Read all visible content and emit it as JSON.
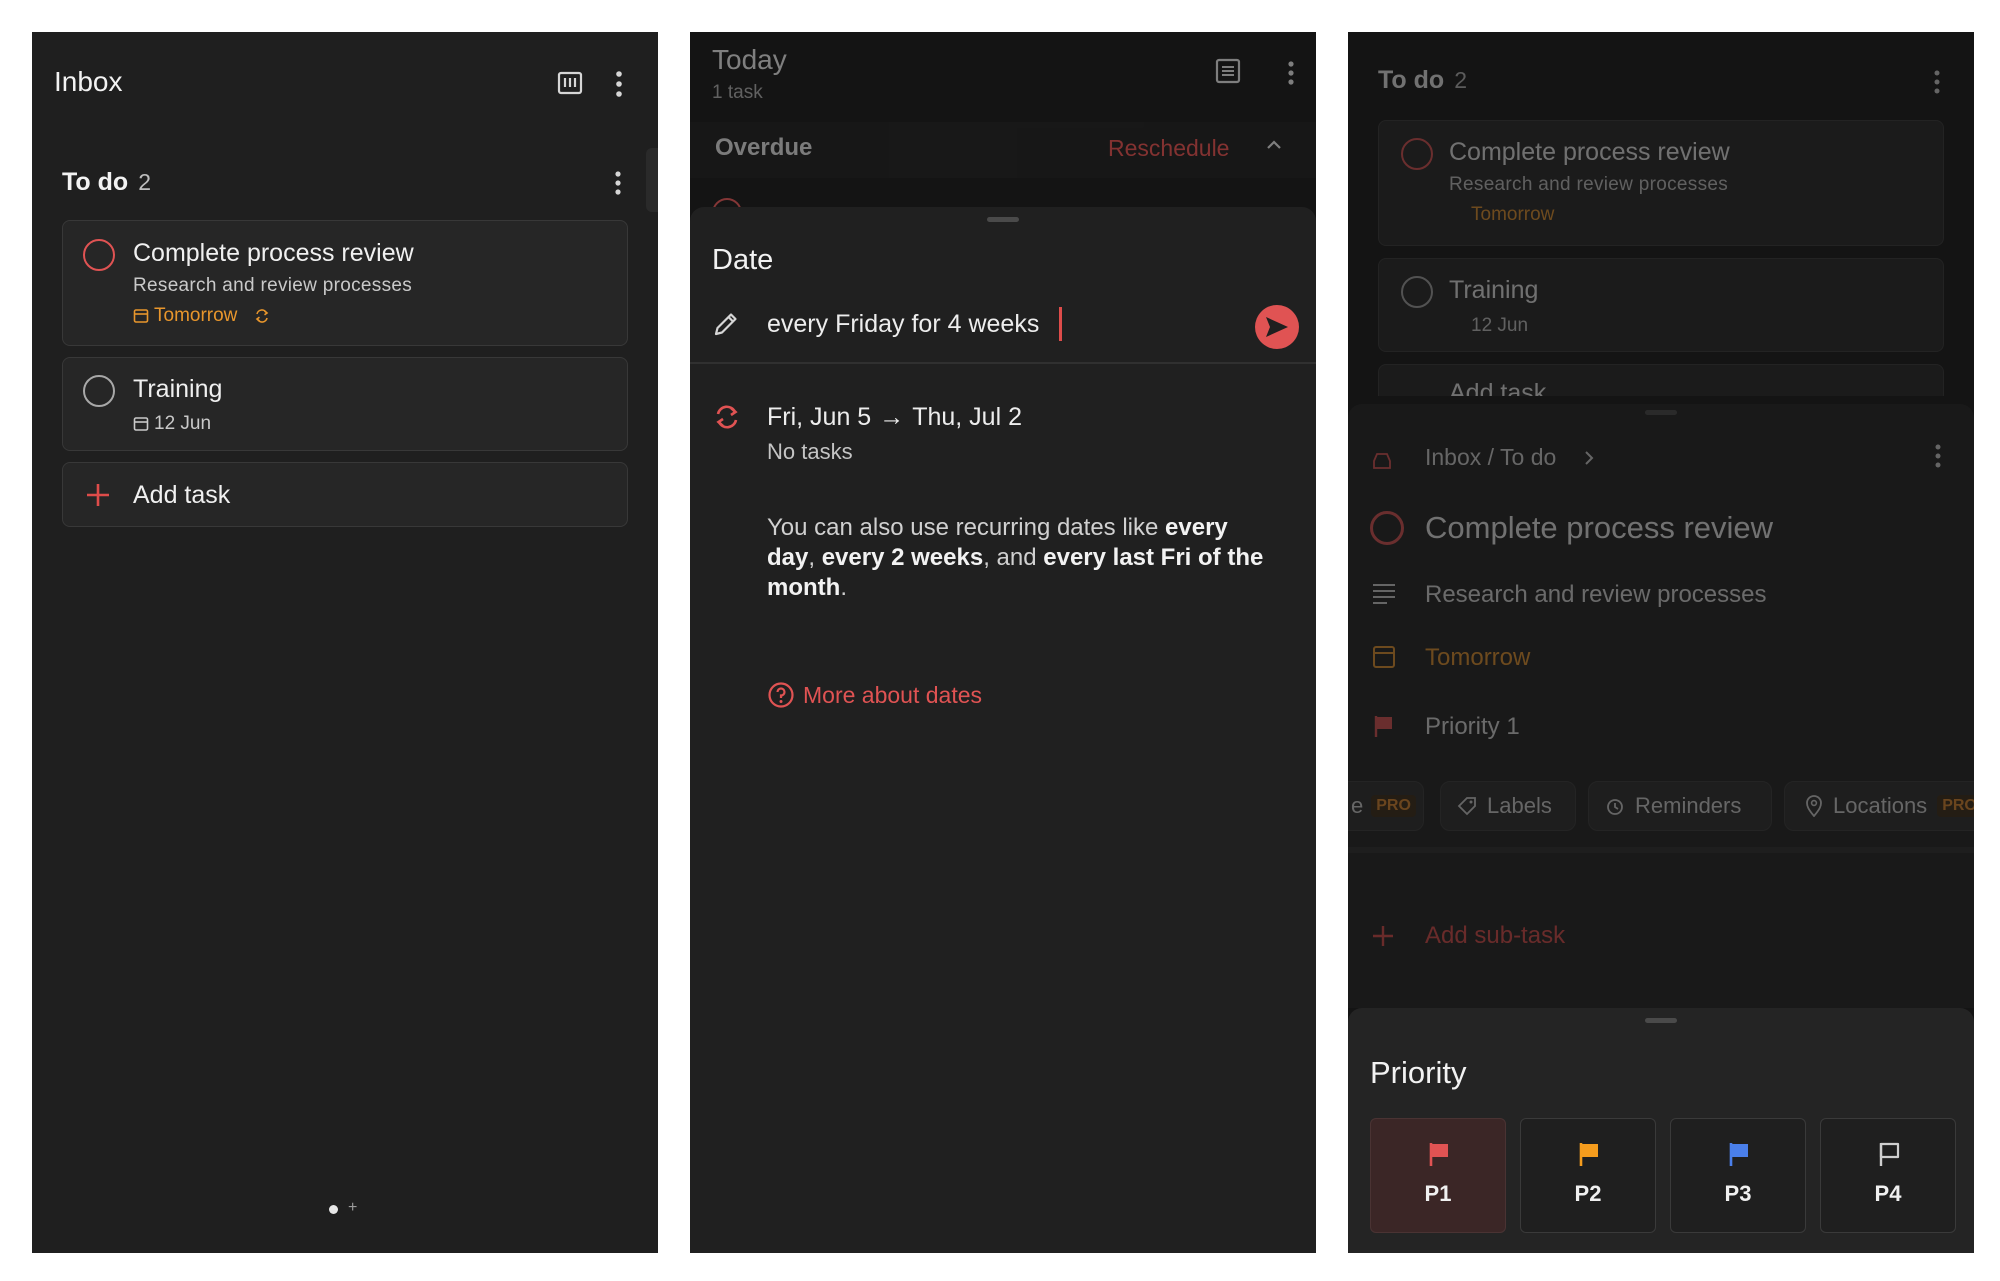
{
  "colors": {
    "accent": "#de4c4a",
    "date_orange": "#e8962c",
    "p1": "#e05353",
    "p2": "#f59c1d",
    "p3": "#4a7fea",
    "p4": "#cfcfcf",
    "panel_bg": "#1f1f1f"
  },
  "inbox": {
    "title": "Inbox",
    "section": {
      "title": "To do",
      "count": "2"
    },
    "tasks": [
      {
        "title": "Complete process review",
        "description": "Research and review processes",
        "date": "Tomorrow"
      },
      {
        "title": "Training",
        "date": "12 Jun"
      }
    ],
    "add_task": "Add task"
  },
  "today": {
    "title": "Today",
    "subtitle": "1 task",
    "overdue": "Overdue",
    "reschedule": "Reschedule",
    "sheet": {
      "title": "Date",
      "input_value": "every Friday for 4 weeks",
      "range_start": "Fri, Jun 5",
      "range_end": "Thu, Jul 2",
      "range_arrow": "→",
      "no_tasks": "No tasks",
      "help_1": "You can also use recurring dates like",
      "help_b1": "every day",
      "help_2": ",",
      "help_b2": "every 2 weeks",
      "help_3": ", and",
      "help_b3": "every last Fri of the month",
      "help_4": ".",
      "more_link": "More about dates"
    }
  },
  "detail": {
    "section": {
      "title": "To do",
      "count": "2"
    },
    "tasks": [
      {
        "title": "Complete process review",
        "description": "Research and review processes",
        "date": "Tomorrow"
      },
      {
        "title": "Training",
        "date": "12 Jun"
      }
    ],
    "add_task": "Add task",
    "breadcrumb": "Inbox / To do",
    "task_title": "Complete process review",
    "description": "Research and review processes",
    "due": "Tomorrow",
    "priority": "Priority 1",
    "chips": {
      "partial": "e",
      "pro": "PRO",
      "labels": "Labels",
      "reminders": "Reminders",
      "locations": "Locations",
      "pro2": "PRO"
    },
    "add_subtask": "Add sub-task",
    "priority_sheet": {
      "title": "Priority",
      "options": [
        "P1",
        "P2",
        "P3",
        "P4"
      ]
    }
  }
}
